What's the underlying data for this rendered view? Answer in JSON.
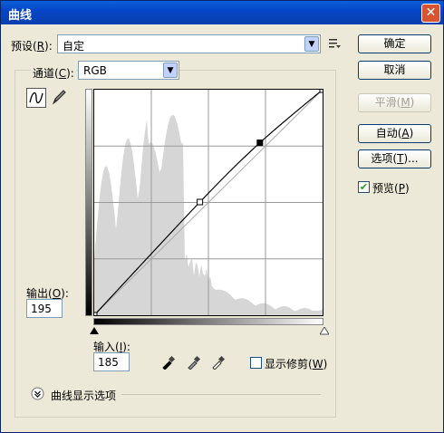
{
  "window": {
    "title": "曲线",
    "close_glyph": "✕"
  },
  "preset": {
    "label_text": "预设(",
    "label_key": "R",
    "label_end": "):",
    "value": "自定",
    "menu_icon": "preset-options-icon"
  },
  "channel": {
    "label_text": "通道(",
    "label_key": "C",
    "label_end": "):",
    "value": "RGB"
  },
  "buttons": {
    "ok": "确定",
    "cancel": "取消",
    "smooth_text": "平滑(",
    "smooth_key": "M",
    "smooth_end": ")",
    "auto_text": "自动(",
    "auto_key": "A",
    "auto_end": ")",
    "options_text": "选项(",
    "options_key": "T",
    "options_end": ")..."
  },
  "preview": {
    "label_text": "预览(",
    "label_key": "P",
    "label_end": ")",
    "checked": true
  },
  "output": {
    "label_text": "输出(",
    "label_key": "O",
    "label_end": "):",
    "value": "195"
  },
  "input": {
    "label_text": "输入(",
    "label_key": "I",
    "label_end": "):",
    "value": "185"
  },
  "clipping": {
    "label_text": "显示修剪(",
    "label_key": "W",
    "label_end": ")",
    "checked": false
  },
  "curve_options": {
    "label": "曲线显示选项"
  },
  "curve": {
    "points": [
      {
        "input": 0,
        "output": 0
      },
      {
        "input": 118,
        "output": 128
      },
      {
        "input": 185,
        "output": 195
      },
      {
        "input": 255,
        "output": 255
      }
    ],
    "selected_point_index": 2
  },
  "colors": {
    "accent": "#0a246a",
    "titlebar": "#0646c8",
    "window_bg": "#ece9d8",
    "histogram": "#d6d6d6"
  },
  "icons": {
    "point_tool": "curve-point-tool-icon",
    "pencil_tool": "pencil-tool-icon",
    "black_point": "black-point-eyedropper-icon",
    "gray_point": "gray-point-eyedropper-icon",
    "white_point": "white-point-eyedropper-icon",
    "expand": "expand-chevron-icon"
  }
}
